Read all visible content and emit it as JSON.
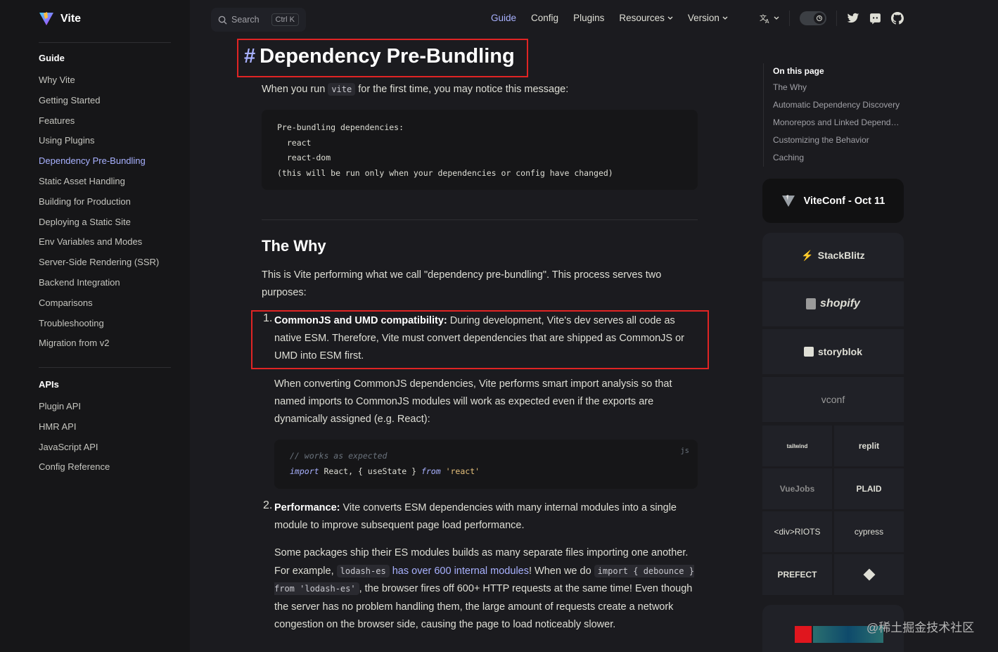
{
  "brand": {
    "name": "Vite",
    "accent": "#a8b1ff",
    "highlight": "#e02424"
  },
  "sidebar": {
    "groups": [
      {
        "title": "Guide",
        "items": [
          "Why Vite",
          "Getting Started",
          "Features",
          "Using Plugins",
          "Dependency Pre-Bundling",
          "Static Asset Handling",
          "Building for Production",
          "Deploying a Static Site",
          "Env Variables and Modes",
          "Server-Side Rendering (SSR)",
          "Backend Integration",
          "Comparisons",
          "Troubleshooting",
          "Migration from v2"
        ],
        "active": "Dependency Pre-Bundling"
      },
      {
        "title": "APIs",
        "items": [
          "Plugin API",
          "HMR API",
          "JavaScript API",
          "Config Reference"
        ]
      }
    ]
  },
  "header": {
    "search_label": "Search",
    "search_shortcut": "Ctrl K",
    "nav": [
      {
        "label": "Guide",
        "active": true,
        "dropdown": false
      },
      {
        "label": "Config",
        "dropdown": false
      },
      {
        "label": "Plugins",
        "dropdown": false
      },
      {
        "label": "Resources",
        "dropdown": true
      },
      {
        "label": "Version",
        "dropdown": true
      }
    ],
    "icons": [
      "translate-icon",
      "theme-toggle",
      "twitter-icon",
      "discord-icon",
      "github-icon"
    ]
  },
  "main": {
    "title": "Dependency Pre-Bundling",
    "intro_before": "When you run ",
    "intro_code": "vite",
    "intro_after": " for the first time, you may notice this message:",
    "code1": [
      "Pre-bundling dependencies:",
      "  react",
      "  react-dom",
      "(this will be run only when your dependencies or config have changed)"
    ],
    "section_title": "The Why",
    "section_intro": "This is Vite performing what we call \"dependency pre-bundling\". This process serves two purposes:",
    "item1_num": "1.",
    "item1_bold": "CommonJS and UMD compatibility:",
    "item1_text": " During development, Vite's dev serves all code as native ESM. Therefore, Vite must convert dependencies that are shipped as CommonJS or UMD into ESM first.",
    "item1_p2": "When converting CommonJS dependencies, Vite performs smart import analysis so that named imports to CommonJS modules will work as expected even if the exports are dynamically assigned (e.g. React):",
    "code2": {
      "lang": "js",
      "comment": "// works as expected",
      "kw1": "import",
      "mid": " React, { useState } ",
      "kw2": "from",
      "str": " 'react'"
    },
    "item2_num": "2.",
    "item2_bold": "Performance:",
    "item2_text": " Vite converts ESM dependencies with many internal modules into a single module to improve subsequent page load performance.",
    "item2_p2_a": "Some packages ship their ES modules builds as many separate files importing one another. For example, ",
    "item2_p2_code1": "lodash-es",
    "item2_p2_link": "has over 600 internal modules",
    "item2_p2_b": "! When we do ",
    "item2_p2_code2": "import { debounce } from 'lodash-es'",
    "item2_p2_c": ", the browser fires off 600+ HTTP requests at the same time! Even though the server has no problem handling them, the large amount of requests create a network congestion on the browser side, causing the page to load noticeably slower."
  },
  "toc": {
    "title": "On this page",
    "items": [
      "The Why",
      "Automatic Dependency Discovery",
      "Monorepos and Linked Dependencies",
      "Customizing the Behavior",
      "Caching"
    ]
  },
  "sponsors": {
    "viteconf": "ViteConf - Oct 11",
    "wide": [
      "StackBlitz",
      "shopify",
      "storyblok",
      "vconf"
    ],
    "grid": [
      "tailwind",
      "replit",
      "VueJobs",
      "PLAID",
      "<div>RIOTS",
      "cypress",
      "PREFECT",
      ""
    ]
  },
  "watermark": "@稀土掘金技术社区"
}
